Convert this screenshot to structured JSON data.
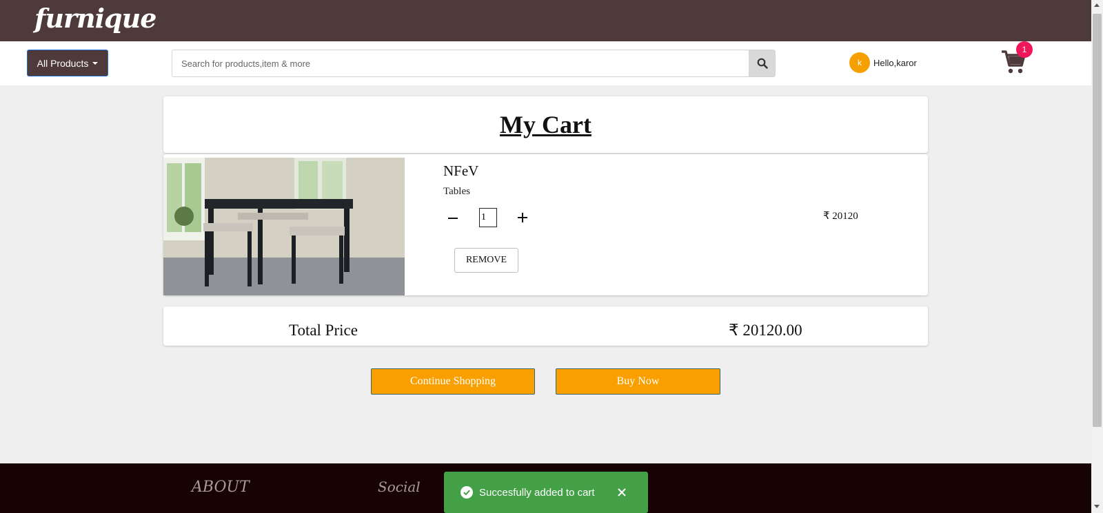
{
  "header": {
    "logo": "furnique",
    "all_products_label": "All Products",
    "search_placeholder": "Search for products,item & more",
    "user_initial": "k",
    "greeting": "Hello,karor",
    "cart_count": "1"
  },
  "cart": {
    "title": "My Cart",
    "items": [
      {
        "name": "NFeV",
        "category": "Tables",
        "quantity": "1",
        "price": "₹ 20120",
        "remove_label": "REMOVE"
      }
    ],
    "total_label": "Total Price",
    "total_value": "₹ 20120.00",
    "continue_label": "Continue Shopping",
    "buy_label": "Buy Now"
  },
  "footer": {
    "about": "ABOUT",
    "social": "Social"
  },
  "toast": {
    "message": "Succesfully added to cart"
  },
  "colors": {
    "brand": "#4e3a3a",
    "accent": "#fa9f00",
    "badge": "#f0165a",
    "success": "#43a047",
    "footer": "#170303"
  },
  "icons": [
    "search-icon",
    "cart-icon",
    "minus-icon",
    "plus-icon",
    "check-circle-icon",
    "close-icon",
    "caret-down-icon"
  ]
}
